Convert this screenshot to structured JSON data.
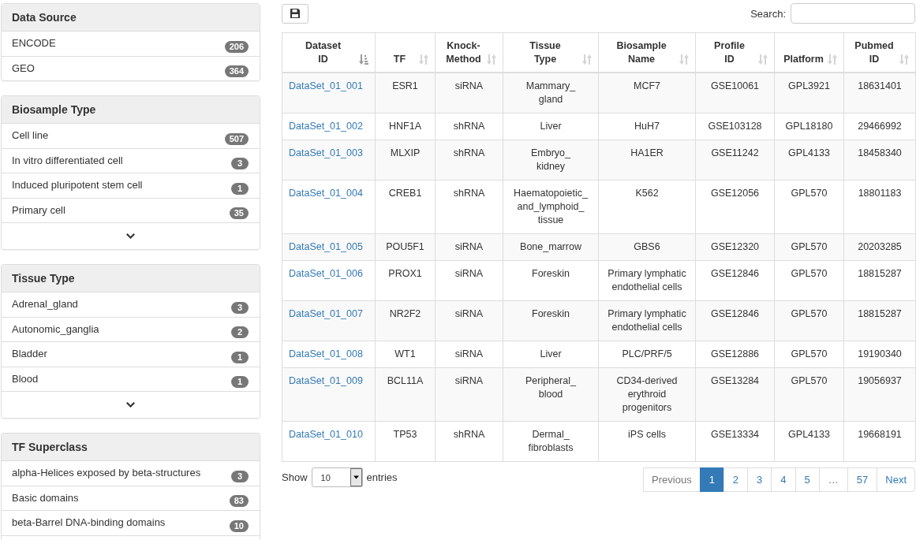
{
  "sidebar": {
    "panels": [
      {
        "title": "Data Source",
        "items": [
          {
            "label": "ENCODE",
            "count": "206"
          },
          {
            "label": "GEO",
            "count": "364"
          }
        ],
        "more": false
      },
      {
        "title": "Biosample Type",
        "items": [
          {
            "label": "Cell line",
            "count": "507"
          },
          {
            "label": "In vitro differentiated cell",
            "count": "3"
          },
          {
            "label": "Induced pluripotent stem cell",
            "count": "1"
          },
          {
            "label": "Primary cell",
            "count": "35"
          }
        ],
        "more": true
      },
      {
        "title": "Tissue Type",
        "items": [
          {
            "label": "Adrenal_gland",
            "count": "3"
          },
          {
            "label": "Autonomic_ganglia",
            "count": "2"
          },
          {
            "label": "Bladder",
            "count": "1"
          },
          {
            "label": "Blood",
            "count": "1"
          }
        ],
        "more": true
      },
      {
        "title": "TF Superclass",
        "items": [
          {
            "label": "alpha-Helices exposed by beta-structures",
            "count": "3"
          },
          {
            "label": "Basic domains",
            "count": "83"
          },
          {
            "label": "beta-Barrel DNA-binding domains",
            "count": "10"
          }
        ],
        "more": false
      }
    ]
  },
  "toolbar": {
    "search": {
      "label": "Search:"
    }
  },
  "table": {
    "columns": [
      {
        "label": "Dataset ID",
        "kind": "link",
        "sorted": true
      },
      {
        "label": "TF",
        "kind": "text",
        "sorted": false
      },
      {
        "label": "Knock-Method",
        "kind": "text",
        "sorted": false
      },
      {
        "label": "Tissue Type",
        "kind": "term",
        "sorted": false
      },
      {
        "label": "Biosample Name",
        "kind": "text",
        "sorted": false
      },
      {
        "label": "Profile ID",
        "kind": "text",
        "sorted": false
      },
      {
        "label": "Platform",
        "kind": "text",
        "sorted": false
      },
      {
        "label": "Pubmed ID",
        "kind": "text",
        "sorted": false
      }
    ],
    "rows": [
      [
        "DataSet_01_001",
        "ESR1",
        "siRNA",
        "Mammary_gland",
        "MCF7",
        "GSE10061",
        "GPL3921",
        "18631401"
      ],
      [
        "DataSet_01_002",
        "HNF1A",
        "shRNA",
        "Liver",
        "HuH7",
        "GSE103128",
        "GPL18180",
        "29466992"
      ],
      [
        "DataSet_01_003",
        "MLXIP",
        "shRNA",
        "Embryo_kidney",
        "HA1ER",
        "GSE11242",
        "GPL4133",
        "18458340"
      ],
      [
        "DataSet_01_004",
        "CREB1",
        "shRNA",
        "Haematopoietic_and_lymphoid_tissue",
        "K562",
        "GSE12056",
        "GPL570",
        "18801183"
      ],
      [
        "DataSet_01_005",
        "POU5F1",
        "siRNA",
        "Bone_marrow",
        "GBS6",
        "GSE12320",
        "GPL570",
        "20203285"
      ],
      [
        "DataSet_01_006",
        "PROX1",
        "siRNA",
        "Foreskin",
        "Primary lymphatic endothelial cells",
        "GSE12846",
        "GPL570",
        "18815287"
      ],
      [
        "DataSet_01_007",
        "NR2F2",
        "siRNA",
        "Foreskin",
        "Primary lymphatic endothelial cells",
        "GSE12846",
        "GPL570",
        "18815287"
      ],
      [
        "DataSet_01_008",
        "WT1",
        "siRNA",
        "Liver",
        "PLC/PRF/5",
        "GSE12886",
        "GPL570",
        "19190340"
      ],
      [
        "DataSet_01_009",
        "BCL11A",
        "siRNA",
        "Peripheral_blood",
        "CD34-derived erythroid progenitors",
        "GSE13284",
        "GPL570",
        "19056937"
      ],
      [
        "DataSet_01_010",
        "TP53",
        "shRNA",
        "Dermal_fibroblasts",
        "iPS cells",
        "GSE13334",
        "GPL4133",
        "19668191"
      ]
    ]
  },
  "length_menu": {
    "label": "Show",
    "value": "10",
    "suffix": "entries"
  },
  "pagination": {
    "previous": {
      "label": "Previous",
      "disabled": true
    },
    "pages": [
      {
        "label": "1",
        "selected": true,
        "disabled": false
      },
      {
        "label": "2",
        "selected": false,
        "disabled": false
      },
      {
        "label": "3",
        "selected": false,
        "disabled": false
      },
      {
        "label": "4",
        "selected": false,
        "disabled": false
      },
      {
        "label": "5",
        "selected": false,
        "disabled": false
      },
      {
        "label": "…",
        "selected": false,
        "disabled": true
      },
      {
        "label": "57",
        "selected": false,
        "disabled": false
      }
    ],
    "next": {
      "label": "Next",
      "disabled": false
    }
  }
}
